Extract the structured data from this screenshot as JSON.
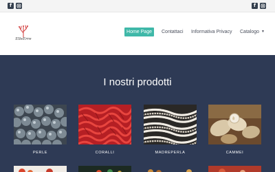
{
  "topbar": {
    "social_left": [
      "facebook-icon",
      "instagram-icon"
    ],
    "social_right": [
      "facebook-icon",
      "instagram-icon"
    ]
  },
  "header": {
    "logo_text": "ElleErre",
    "nav": [
      {
        "label": "Home Page",
        "active": true
      },
      {
        "label": "Contattaci",
        "active": false
      },
      {
        "label": "Informativa Privacy",
        "active": false
      },
      {
        "label": "Catalogo",
        "active": false,
        "has_dropdown": true
      }
    ]
  },
  "main": {
    "title": "I nostri prodotti",
    "products": [
      {
        "label": "PERLE"
      },
      {
        "label": "CORALLI"
      },
      {
        "label": "MADREPERLA"
      },
      {
        "label": "CAMMEI"
      }
    ]
  },
  "colors": {
    "accent": "#3fb8a8",
    "main_background": "#2e3a55",
    "topbar_background": "#f4f4f4"
  }
}
